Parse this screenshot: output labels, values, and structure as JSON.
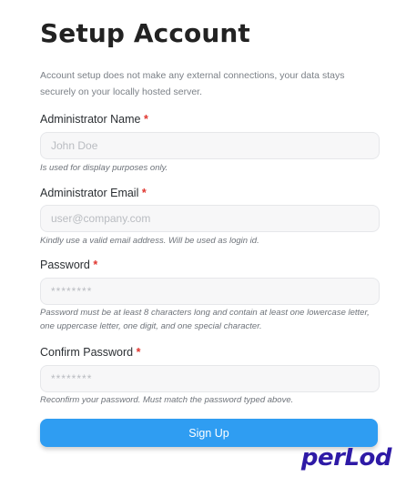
{
  "page": {
    "title": "Setup Account",
    "intro": "Account setup does not make any external connections, your data stays securely on your locally hosted server."
  },
  "form": {
    "name": {
      "label": "Administrator Name",
      "required_mark": "*",
      "placeholder": "John Doe",
      "value": "",
      "hint": "Is used for display purposes only."
    },
    "email": {
      "label": "Administrator Email",
      "required_mark": "*",
      "placeholder": "user@company.com",
      "value": "",
      "hint": "Kindly use a valid email address. Will be used as login id."
    },
    "password": {
      "label": "Password",
      "required_mark": "*",
      "placeholder": "********",
      "value": "",
      "hint": "Password must be at least 8 characters long and contain at least one lowercase letter, one uppercase letter, one digit, and one special character."
    },
    "confirm_password": {
      "label": "Confirm Password",
      "required_mark": "*",
      "placeholder": "********",
      "value": "",
      "hint": "Reconfirm your password. Must match the password typed above."
    },
    "submit_label": "Sign Up"
  },
  "branding": {
    "logo_text": "perLod"
  },
  "colors": {
    "primary_button": "#2f9df2",
    "required": "#e0362f",
    "logo": "#2e1aa6"
  }
}
